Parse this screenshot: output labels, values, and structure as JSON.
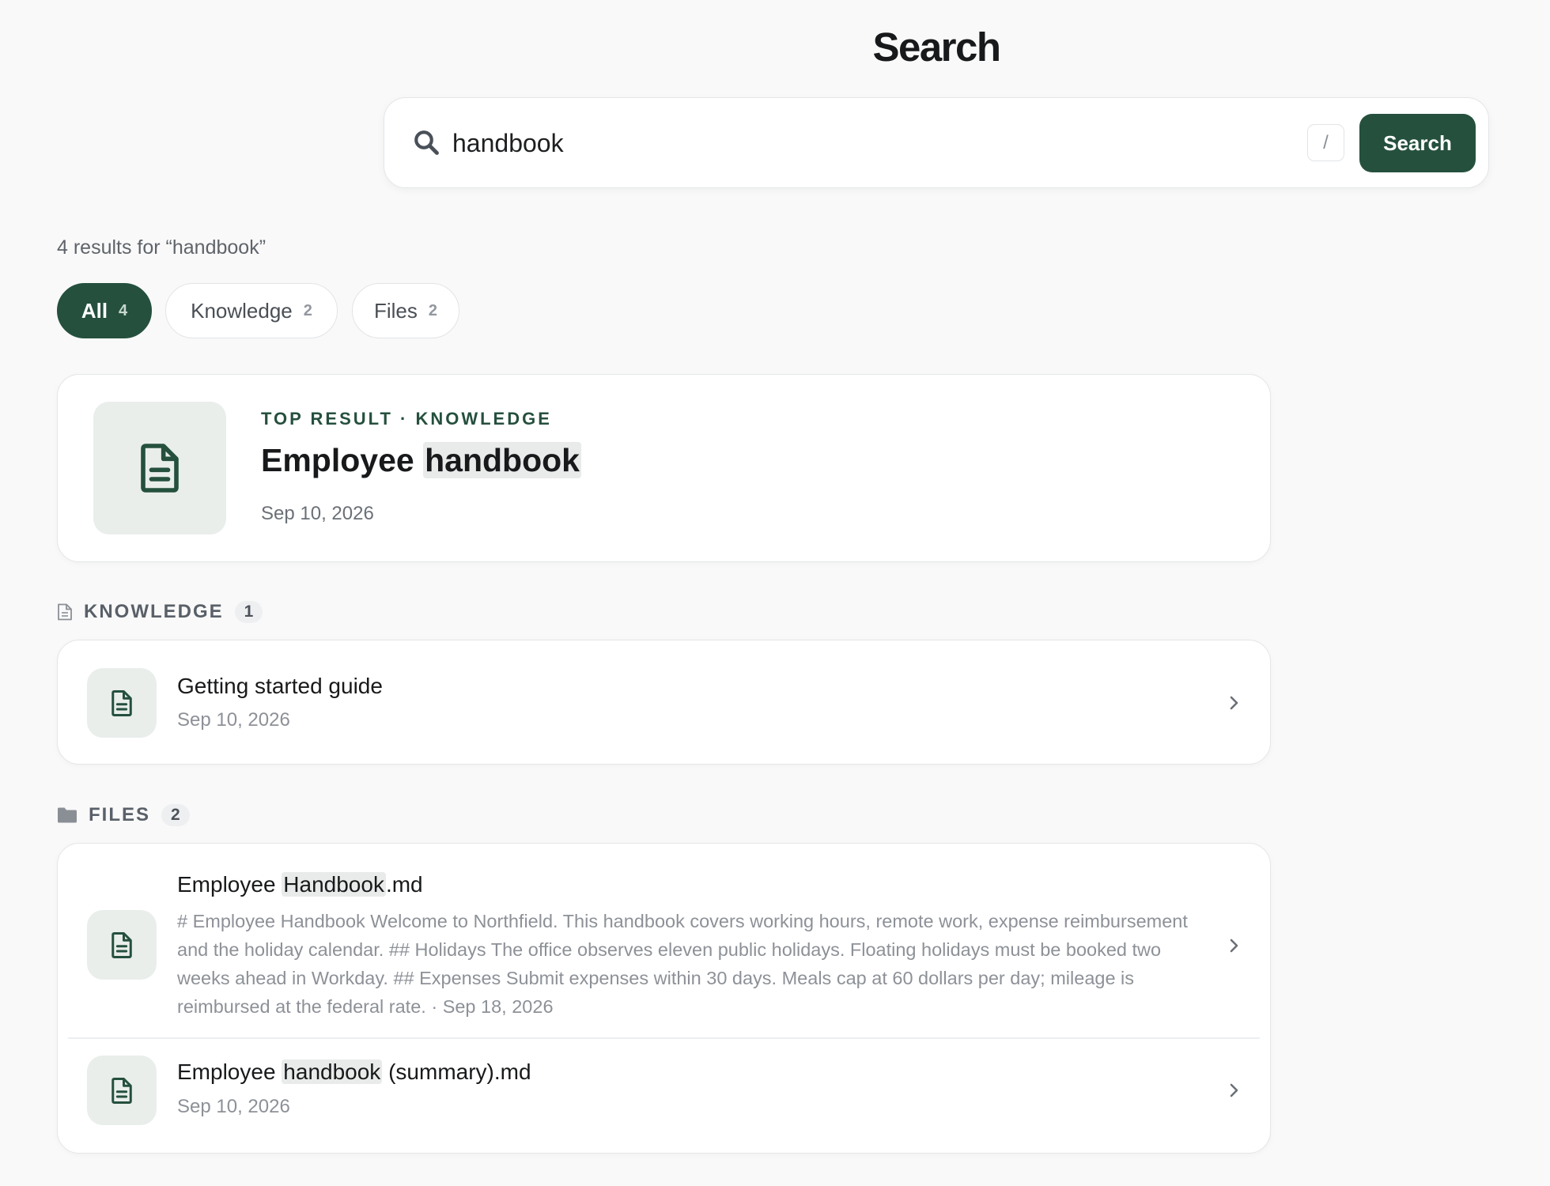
{
  "page": {
    "title": "Search"
  },
  "search": {
    "value": "handbook",
    "placeholder": "",
    "shortcut_hint": "/",
    "button_label": "Search"
  },
  "results_summary": "4 results for “handbook”",
  "filters": [
    {
      "label": "All",
      "count": "4",
      "active": true
    },
    {
      "label": "Knowledge",
      "count": "2",
      "active": false
    },
    {
      "label": "Files",
      "count": "2",
      "active": false
    }
  ],
  "top_result": {
    "kicker": "TOP RESULT · KNOWLEDGE",
    "title_prefix": "Employee ",
    "title_highlight": "handbook",
    "date": "Sep 10, 2026",
    "icon": "document-icon"
  },
  "sections": {
    "knowledge": {
      "label": "KNOWLEDGE",
      "count": "1",
      "icon": "document-outline-icon",
      "items": [
        {
          "title": "Getting started guide",
          "date": "Sep 10, 2026",
          "icon": "document-icon"
        }
      ]
    },
    "files": {
      "label": "FILES",
      "count": "2",
      "icon": "folder-icon",
      "items": [
        {
          "title_prefix": "Employee ",
          "title_highlight": "Handbook",
          "title_suffix": ".md",
          "snippet": "# Employee Handbook Welcome to Northfield. This handbook covers working hours, remote work, expense reimbursement and the holiday calendar. ## Holidays The office observes eleven public holidays. Floating holidays must be booked two weeks ahead in Workday. ## Expenses Submit expenses within 30 days. Meals cap at 60 dollars per day; mileage is reimbursed at the federal rate. · Sep 18, 2026",
          "icon": "document-icon"
        },
        {
          "title_prefix": "Employee ",
          "title_highlight": "handbook",
          "title_suffix": " (summary).md",
          "date": "Sep 10, 2026",
          "icon": "document-icon"
        }
      ]
    }
  },
  "colors": {
    "accent": "#25503e",
    "background": "#f9f9f9",
    "card": "#ffffff",
    "icon_tile": "#e9eeeb",
    "highlight": "#e8ebea"
  }
}
